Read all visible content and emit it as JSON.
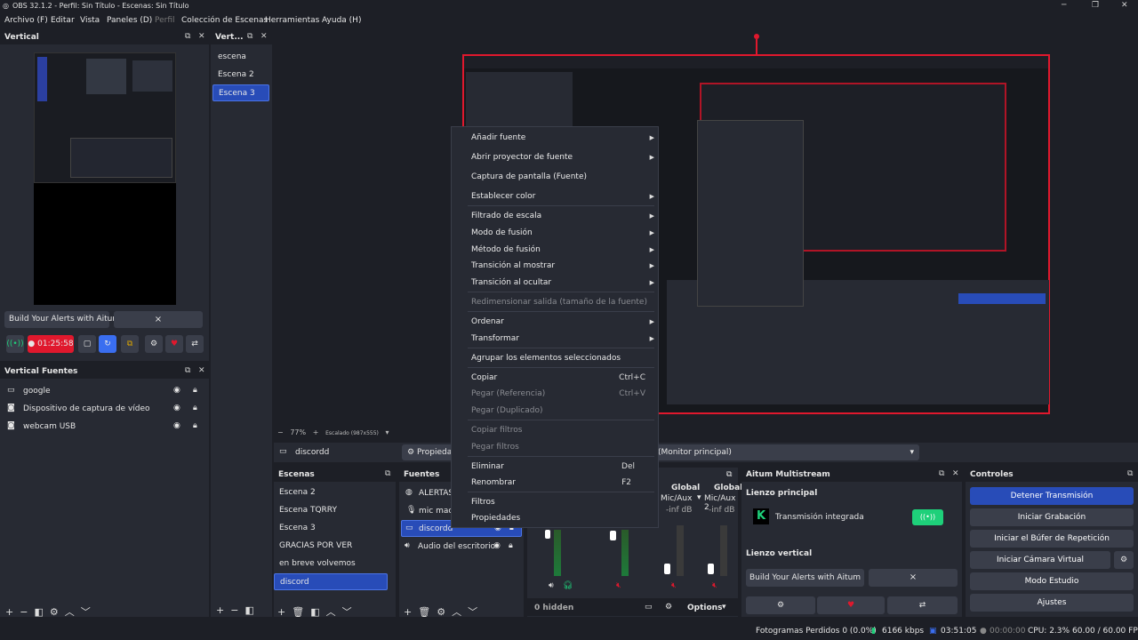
{
  "window": {
    "title": "OBS 32.1.2 - Perfil: Sin Título - Escenas: Sin Título"
  },
  "menu": [
    "Archivo (F)",
    "Editar",
    "Vista",
    "Paneles (D)",
    "Perfil",
    "Colección de Escenas",
    "Herramientas",
    "Ayuda (H)"
  ],
  "vertical": {
    "title": "Vertical",
    "alert_label": "Build Your Alerts with Aitum",
    "timer": "01:25:58",
    "close": "×"
  },
  "vert_scenes": {
    "title": "Vert...",
    "items": [
      "escena",
      "Escena 2",
      "Escena 3"
    ],
    "selected": 2
  },
  "vertical_sources": {
    "title": "Vertical Fuentes",
    "items": [
      "google",
      "Dispositivo de captura de vídeo",
      "webcam USB"
    ]
  },
  "preview": {
    "zoom": "77%",
    "scale": "Escalado (987x555)"
  },
  "source_bar": {
    "name": "discordd",
    "props": "Propieda",
    "monitor": "(Monitor principal)"
  },
  "scenes": {
    "title": "Escenas",
    "items": [
      "Escena 2",
      "Escena TQRRY",
      "Escena 3",
      "GRACIAS POR VER",
      "en breve volvemos",
      "discord"
    ],
    "selected": 5
  },
  "sources": {
    "title": "Fuentes",
    "items": [
      "ALERTAS",
      "mic maor",
      "discordd",
      "Audio del escritorio"
    ],
    "selected": 2
  },
  "mixer": {
    "labels": [
      "Global",
      "Global"
    ],
    "channels": [
      "Mic/Aux",
      "Mic/Aux 2"
    ],
    "db": [
      "-inf dB",
      "-inf dB"
    ],
    "hidden": "0 hidden",
    "options": "Options"
  },
  "aitum": {
    "title": "Aitum Multistream",
    "main_canvas": "Lienzo principal",
    "integrated": "Transmisión integrada",
    "vertical_canvas": "Lienzo vertical",
    "alert_label": "Build Your Alerts with Aitum",
    "close": "×"
  },
  "controls": {
    "title": "Controles",
    "buttons": [
      "Detener Transmisión",
      "Iniciar Grabación",
      "Iniciar el Búfer de Repetición",
      "Iniciar Cámara Virtual",
      "Modo Estudio",
      "Ajustes"
    ]
  },
  "context_menu": {
    "items": [
      {
        "label": "Añadir fuente",
        "arrow": true
      },
      {
        "label": "Abrir proyector de fuente",
        "arrow": true
      },
      {
        "label": "Captura de pantalla (Fuente)"
      },
      {
        "label": "Establecer color",
        "arrow": true
      },
      {
        "label": "Filtrado de escala",
        "arrow": true
      },
      {
        "label": "Modo de fusión",
        "arrow": true
      },
      {
        "label": "Método de fusión",
        "arrow": true
      },
      {
        "label": "Transición al mostrar",
        "arrow": true
      },
      {
        "label": "Transición al ocultar",
        "arrow": true
      },
      {
        "label": "Redimensionar salida (tamaño de la fuente)",
        "disabled": true
      },
      {
        "label": "Ordenar",
        "arrow": true
      },
      {
        "label": "Transformar",
        "arrow": true
      },
      {
        "label": "Agrupar los elementos seleccionados"
      },
      {
        "label": "Copiar",
        "shortcut": "Ctrl+C"
      },
      {
        "label": "Pegar (Referencia)",
        "shortcut": "Ctrl+V",
        "disabled": true
      },
      {
        "label": "Pegar (Duplicado)",
        "disabled": true
      },
      {
        "label": "Copiar filtros",
        "disabled": true
      },
      {
        "label": "Pegar filtros",
        "disabled": true
      },
      {
        "label": "Eliminar",
        "shortcut": "Del"
      },
      {
        "label": "Renombrar",
        "shortcut": "F2"
      },
      {
        "label": "Filtros"
      },
      {
        "label": "Propiedades"
      }
    ]
  },
  "status": {
    "dropped": "Fotogramas Perdidos 0 (0.0%)",
    "kbps": "6166 kbps",
    "stream_time": "03:51:05",
    "rec_time": "00:00:00",
    "cpu": "CPU: 2.3%",
    "fps": "60.00 / 60.00 FPS"
  },
  "colors": {
    "accent": "#284cb8",
    "live_red": "#e0182d",
    "green": "#1ed07a"
  }
}
